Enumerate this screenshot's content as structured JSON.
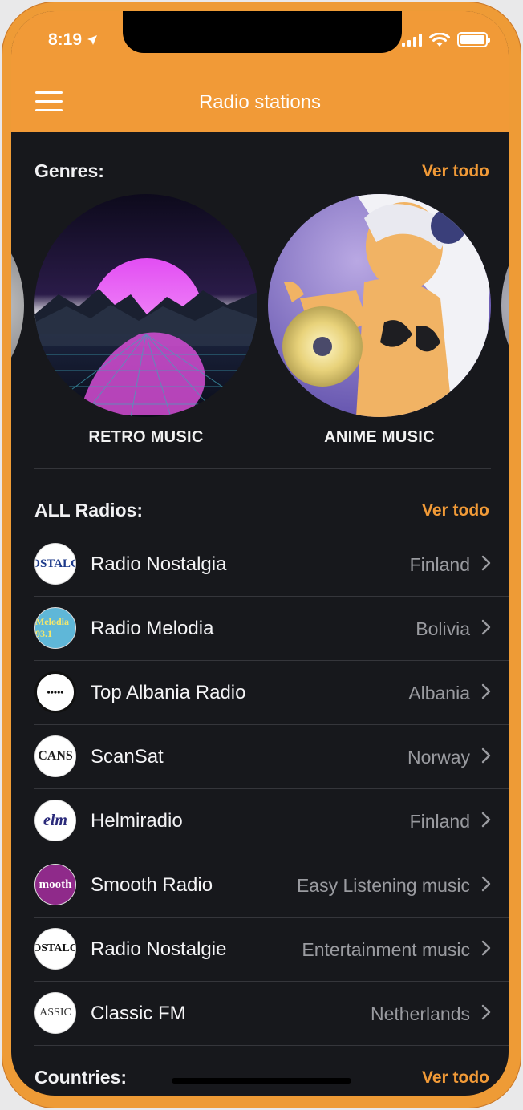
{
  "status_bar": {
    "time": "8:19"
  },
  "header": {
    "title": "Radio stations"
  },
  "genres": {
    "title": "Genres:",
    "view_all": "Ver todo",
    "items": [
      {
        "label": "RETRO MUSIC"
      },
      {
        "label": "ANIME MUSIC"
      }
    ]
  },
  "all_radios": {
    "title": "ALL Radios:",
    "view_all": "Ver todo",
    "items": [
      {
        "name": "Radio Nostalgia",
        "meta": "Finland",
        "logo_text": "OSTALG"
      },
      {
        "name": "Radio Melodia",
        "meta": "Bolivia",
        "logo_text": "Melodia 93.1"
      },
      {
        "name": "Top Albania Radio",
        "meta": "Albania",
        "logo_text": "•••••"
      },
      {
        "name": "ScanSat",
        "meta": "Norway",
        "logo_text": "CANS"
      },
      {
        "name": "Helmiradio",
        "meta": "Finland",
        "logo_text": "elm"
      },
      {
        "name": "Smooth Radio",
        "meta": "Easy Listening music",
        "logo_text": "mooth"
      },
      {
        "name": "Radio Nostalgie",
        "meta": "Entertainment music",
        "logo_text": "OSTALG"
      },
      {
        "name": "Classic FM",
        "meta": "Netherlands",
        "logo_text": "ASSIC"
      }
    ]
  },
  "countries": {
    "title": "Countries:",
    "view_all": "Ver todo"
  },
  "colors": {
    "accent": "#f19a37",
    "background": "#17181c",
    "text": "#f4f4f6",
    "muted": "#9a9ba0"
  }
}
